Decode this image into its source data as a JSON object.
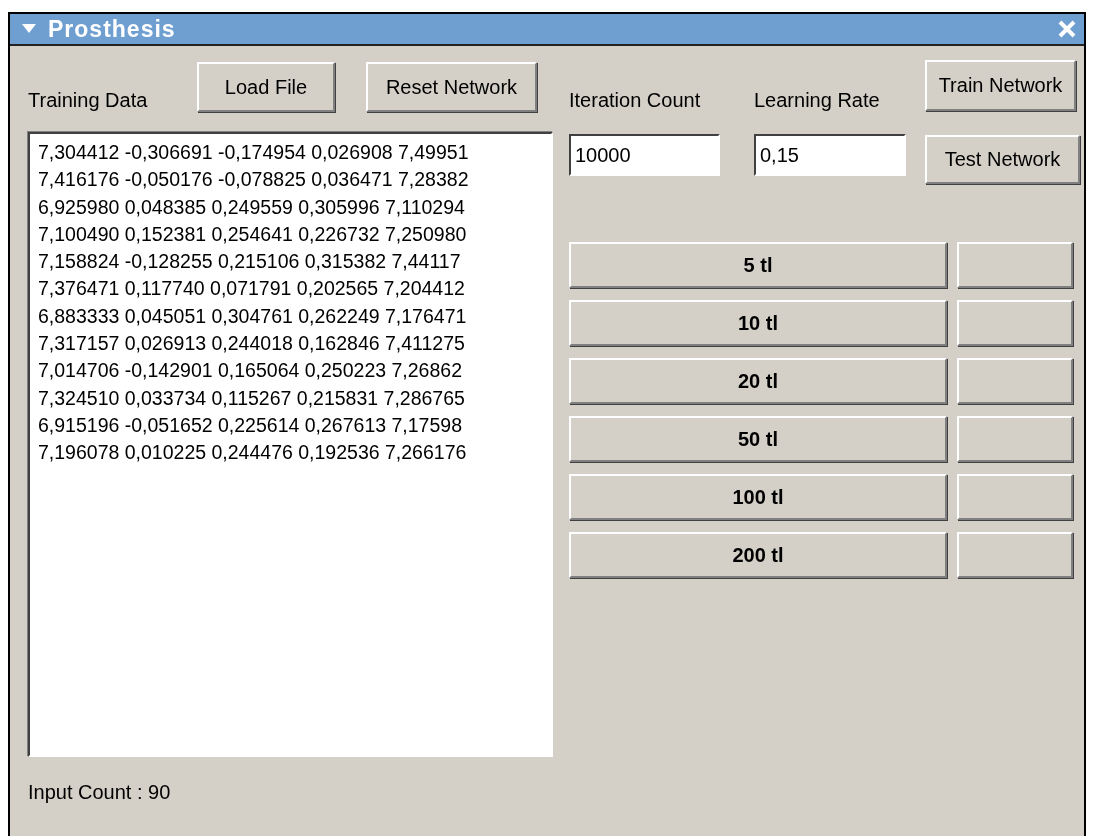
{
  "window": {
    "title": "Prosthesis"
  },
  "training_data": {
    "label": "Training Data",
    "lines": [
      "7,304412 -0,306691 -0,174954 0,026908 7,49951",
      "7,416176 -0,050176 -0,078825 0,036471 7,28382",
      "6,925980 0,048385 0,249559 0,305996 7,110294",
      "7,100490 0,152381 0,254641 0,226732 7,250980",
      "7,158824 -0,128255 0,215106 0,315382 7,44117",
      "7,376471 0,117740 0,071791 0,202565 7,204412",
      "6,883333 0,045051 0,304761 0,262249 7,176471",
      "7,317157 0,026913 0,244018 0,162846 7,411275",
      "7,014706 -0,142901 0,165064 0,250223 7,26862",
      "7,324510 0,033734 0,115267 0,215831 7,286765",
      "6,915196 -0,051652 0,225614 0,267613 7,17598",
      "7,196078 0,010225 0,244476 0,192536 7,266176"
    ]
  },
  "load_button": "Load File",
  "reset_button": "Reset Network",
  "iteration_count": {
    "label": "Iteration Count",
    "value": "10000"
  },
  "learning_rate": {
    "label": "Learning Rate",
    "value": "0,15"
  },
  "train_button": "Train Network",
  "test_button": "Test Network",
  "amount_buttons": [
    {
      "label": "5 tl"
    },
    {
      "label": "10 tl"
    },
    {
      "label": "20 tl"
    },
    {
      "label": "50 tl"
    },
    {
      "label": "100 tl"
    },
    {
      "label": "200 tl"
    }
  ],
  "status": "Input Count : 90"
}
